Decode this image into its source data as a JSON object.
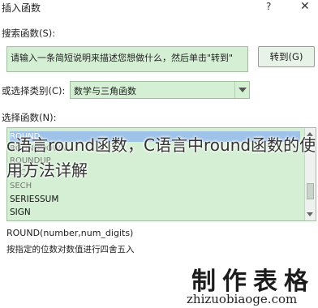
{
  "dialog": {
    "title": "插入函数",
    "help_label": "?",
    "close_label": "✕"
  },
  "search": {
    "label": "搜索函数(S):",
    "value": "请输入一条简短说明来描述您想做什么，然后单击\"转到\"",
    "go_button": "转到(G)"
  },
  "category": {
    "label": "或选择类别(C):",
    "selected": "数学与三角函数"
  },
  "functions": {
    "label": "选择函数(N):",
    "items": [
      "ROUND",
      "ROUNDDOWN",
      "ROUNDUP",
      "SEC",
      "SECH",
      "SERIESSUM",
      "SIGN"
    ],
    "selected_index": 0
  },
  "syntax": "ROUND(number,num_digits)",
  "description": "按指定的位数对数值进行四舍五入",
  "overlay_caption": "c语言round函数，C语言中round函数的使用方法详解",
  "watermark": {
    "brand": "制作表格",
    "url": "zhizuobiaoge.com"
  }
}
